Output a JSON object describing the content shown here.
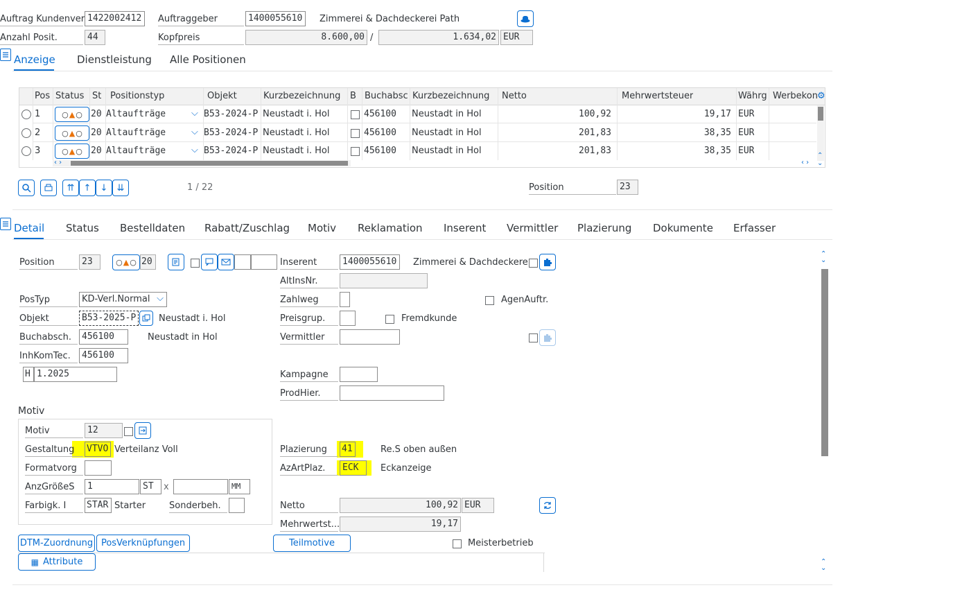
{
  "header": {
    "auftrag_label": "Auftrag Kundenver...",
    "auftrag_value": "1422002412",
    "auftraggeber_label": "Auftraggeber",
    "auftraggeber_value": "1400055610",
    "auftraggeber_name": "Zimmerei & Dachdeckerei Path",
    "anzahl_label": "Anzahl Posit.",
    "anzahl_value": "44",
    "kopfpreis_label": "Kopfpreis",
    "kopfpreis_value": "8.600,00",
    "slash": "/",
    "kopfpreis_tax": "1.634,02",
    "currency": "EUR"
  },
  "top_tabs": [
    "Anzeige",
    "Dienstleistung",
    "Alle Positionen"
  ],
  "grid": {
    "columns": [
      "Pos",
      "Status",
      "St",
      "Positionstyp",
      "Objekt",
      "Kurzbezeichnung",
      "B",
      "Buchabsc",
      "Kurzbezeichnung",
      "Netto",
      "Mehrwertsteuer",
      "Währg",
      "Werbekon"
    ],
    "rows": [
      {
        "pos": "1",
        "st": "20",
        "typ": "Altaufträge",
        "objekt": "B53-2024-P",
        "kurz": "Neustadt i. Hol",
        "buch": "456100",
        "kurz2": "Neustadt in Hol",
        "netto": "100,92",
        "mwst": "19,17",
        "waehrg": "EUR"
      },
      {
        "pos": "2",
        "st": "20",
        "typ": "Altaufträge",
        "objekt": "B53-2024-P",
        "kurz": "Neustadt i. Hol",
        "buch": "456100",
        "kurz2": "Neustadt in Hol",
        "netto": "201,83",
        "mwst": "38,35",
        "waehrg": "EUR"
      },
      {
        "pos": "3",
        "st": "20",
        "typ": "Altaufträge",
        "objekt": "B53-2024-P",
        "kurz": "Neustadt i. Hol",
        "buch": "456100",
        "kurz2": "Neustadt in Hol",
        "netto": "201,83",
        "mwst": "38,35",
        "waehrg": "EUR"
      }
    ]
  },
  "toolbar": {
    "page": "1 / 22",
    "position_label": "Position",
    "position_value": "23"
  },
  "detail_tabs": [
    "Detail",
    "Status",
    "Bestelldaten",
    "Rabatt/Zuschlag",
    "Motiv",
    "Reklamation",
    "Inserent",
    "Vermittler",
    "Plazierung",
    "Dokumente",
    "Erfasser"
  ],
  "detail": {
    "position_label": "Position",
    "position_value": "23",
    "status_code": "20",
    "inserent_label": "Inserent",
    "inserent_value": "1400055610",
    "inserent_name": "Zimmerei & Dachdeckere...",
    "altins_label": "AltInsNr.",
    "postyp_label": "PosTyp",
    "postyp_value": "KD-Verl.Normal",
    "zahlweg_label": "Zahlweg",
    "agenauftr_label": "AgenAuftr.",
    "objekt_label": "Objekt",
    "objekt_value": "B53-2025-P",
    "objekt_text": "Neustadt i. Hol",
    "preisgrup_label": "Preisgrup.",
    "fremdkunde_label": "Fremdkunde",
    "buchabsch_label": "Buchabsch.",
    "buchabsch_value": "456100",
    "buchabsch_text": "Neustadt in Hol",
    "vermittler_label": "Vermittler",
    "inhkom_label": "InhKomTec.",
    "inhkom_value": "456100",
    "h_value": "H",
    "date_value": "1.2025",
    "kampagne_label": "Kampagne",
    "prodhier_label": "ProdHier.",
    "motiv_title": "Motiv",
    "motiv_label": "Motiv",
    "motiv_value": "12",
    "gestaltung_label": "Gestaltung",
    "gestaltung_value": "VTVO",
    "gestaltung_text": "Verteilanz Voll",
    "plazierung_label": "Plazierung",
    "plazierung_value": "41",
    "plazierung_text": "Re.S oben außen",
    "formatvorg_label": "Formatvorg",
    "azart_label": "AzArtPlaz.",
    "azart_value": "ECK",
    "azart_text": "Eckanzeige",
    "anzgroesse_label": "AnzGrößeS",
    "anzgroesse_value": "1",
    "st_unit": "ST",
    "x_sep": "x",
    "mm_unit": "MM",
    "farbigk_label": "Farbigk. I",
    "farbigk_value": "STAR",
    "farbigk_text": "Starter",
    "sonderbeh_label": "Sonderbeh.",
    "netto_label": "Netto",
    "netto_value": "100,92",
    "netto_currency": "EUR",
    "mwst_label": "Mehrwertst...",
    "mwst_value": "19,17",
    "dtm_button": "DTM-Zuordnung",
    "posverkn_button": "PosVerknüpfungen",
    "teilmotive_button": "Teilmotive",
    "meisterbetrieb_label": "Meisterbetrieb",
    "attribute_button": "Attribute"
  }
}
